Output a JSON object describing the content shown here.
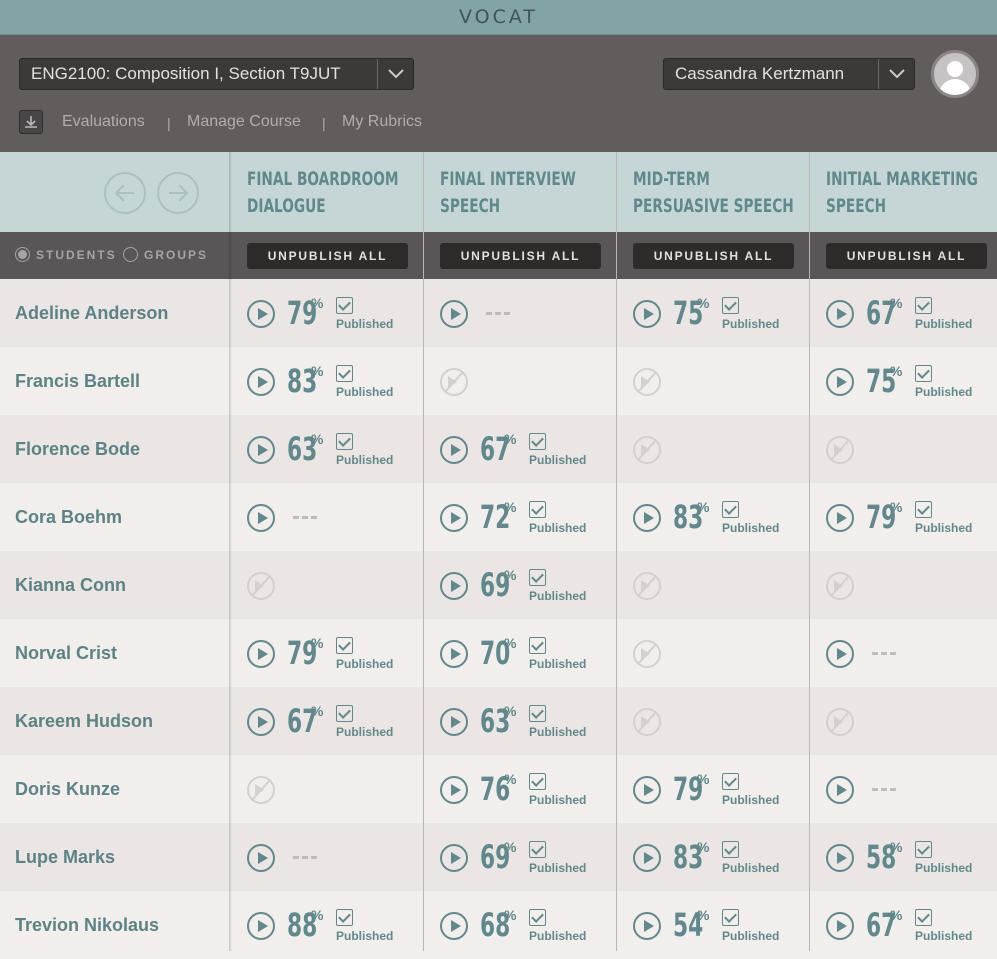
{
  "brand": {
    "logo": "VOCAT"
  },
  "header": {
    "course": "ENG2100: Composition I, Section T9JUT",
    "user": "Cassandra Kertzmann",
    "nav": [
      "Evaluations",
      "Manage Course",
      "My Rubrics"
    ],
    "nav_separator": "|"
  },
  "filters": {
    "students": "STUDENTS",
    "groups": "GROUPS",
    "selected": "STUDENTS"
  },
  "columns": [
    {
      "title_line1": "FINAL BOARDROOM",
      "title_line2": "DIALOGUE",
      "unpublish": "UNPUBLISH ALL"
    },
    {
      "title_line1": "FINAL INTERVIEW",
      "title_line2": "SPEECH",
      "unpublish": "UNPUBLISH ALL"
    },
    {
      "title_line1": "MID-TERM",
      "title_line2": "PERSUASIVE SPEECH",
      "unpublish": "UNPUBLISH ALL"
    },
    {
      "title_line1": "INITIAL MARKETING",
      "title_line2": "SPEECH",
      "unpublish": "UNPUBLISH ALL"
    }
  ],
  "labels": {
    "published": "Published",
    "percent": "%"
  },
  "colors": {
    "accent": "#5f898c",
    "header_bg": "#625c5d",
    "brand_bg": "#82a4a6"
  },
  "students": [
    {
      "name": "Adeline Anderson",
      "cells": [
        {
          "state": "scored",
          "score": "79"
        },
        {
          "state": "pending"
        },
        {
          "state": "scored",
          "score": "75"
        },
        {
          "state": "scored",
          "score": "67"
        }
      ]
    },
    {
      "name": "Francis Bartell",
      "cells": [
        {
          "state": "scored",
          "score": "83"
        },
        {
          "state": "none"
        },
        {
          "state": "none"
        },
        {
          "state": "scored",
          "score": "75"
        }
      ]
    },
    {
      "name": "Florence Bode",
      "cells": [
        {
          "state": "scored",
          "score": "63"
        },
        {
          "state": "scored",
          "score": "67"
        },
        {
          "state": "none"
        },
        {
          "state": "none"
        }
      ]
    },
    {
      "name": "Cora Boehm",
      "cells": [
        {
          "state": "pending"
        },
        {
          "state": "scored",
          "score": "72"
        },
        {
          "state": "scored",
          "score": "83"
        },
        {
          "state": "scored",
          "score": "79"
        }
      ]
    },
    {
      "name": "Kianna Conn",
      "cells": [
        {
          "state": "none"
        },
        {
          "state": "scored",
          "score": "69"
        },
        {
          "state": "none"
        },
        {
          "state": "none"
        }
      ]
    },
    {
      "name": "Norval Crist",
      "cells": [
        {
          "state": "scored",
          "score": "79"
        },
        {
          "state": "scored",
          "score": "70"
        },
        {
          "state": "none"
        },
        {
          "state": "pending"
        }
      ]
    },
    {
      "name": "Kareem Hudson",
      "cells": [
        {
          "state": "scored",
          "score": "67"
        },
        {
          "state": "scored",
          "score": "63"
        },
        {
          "state": "none"
        },
        {
          "state": "none"
        }
      ]
    },
    {
      "name": "Doris Kunze",
      "cells": [
        {
          "state": "none"
        },
        {
          "state": "scored",
          "score": "76"
        },
        {
          "state": "scored",
          "score": "79"
        },
        {
          "state": "pending"
        }
      ]
    },
    {
      "name": "Lupe Marks",
      "cells": [
        {
          "state": "pending"
        },
        {
          "state": "scored",
          "score": "69"
        },
        {
          "state": "scored",
          "score": "83"
        },
        {
          "state": "scored",
          "score": "58"
        }
      ]
    },
    {
      "name": "Trevion Nikolaus",
      "cells": [
        {
          "state": "scored",
          "score": "88"
        },
        {
          "state": "scored",
          "score": "68"
        },
        {
          "state": "scored",
          "score": "54"
        },
        {
          "state": "scored",
          "score": "67"
        }
      ]
    }
  ]
}
